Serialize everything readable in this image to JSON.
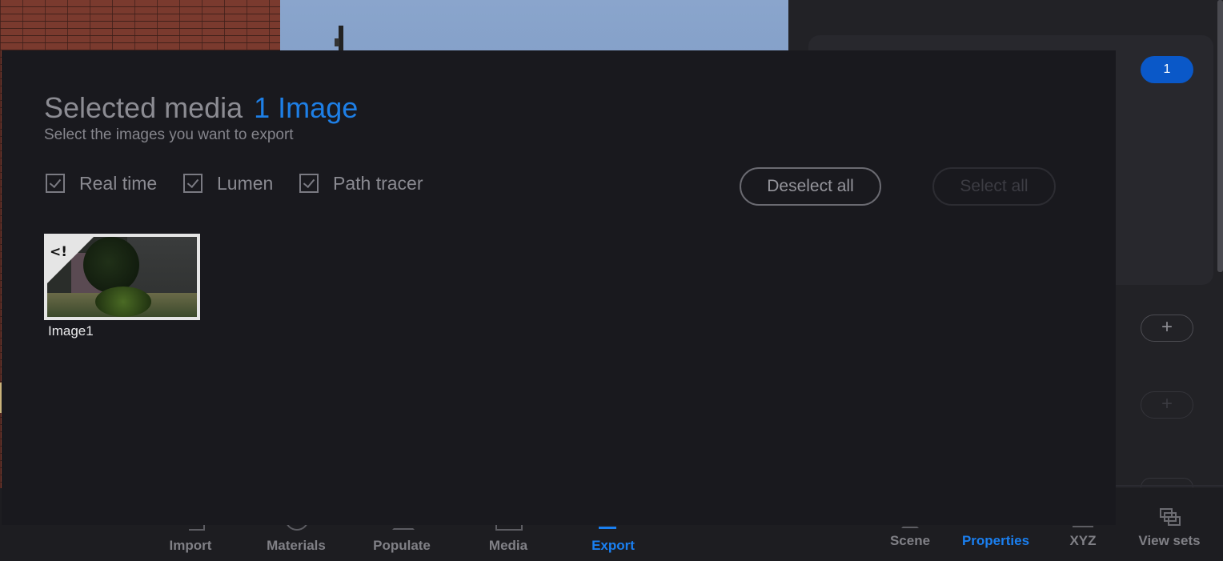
{
  "modal": {
    "title": "Selected media",
    "count_label": "1 Image",
    "subtitle": "Select the images you want to export",
    "filters": [
      {
        "label": "Real time",
        "checked": true
      },
      {
        "label": "Lumen",
        "checked": true
      },
      {
        "label": "Path tracer",
        "checked": true
      }
    ],
    "deselect_all": "Deselect all",
    "select_all": "Select all",
    "images": [
      {
        "name": "Image1",
        "badge_icon": "realtime-renderer-icon",
        "selected": true
      }
    ]
  },
  "right_panel": {
    "count_badge": "1",
    "add_icon": "plus-icon"
  },
  "toolbar": {
    "left_items": [
      {
        "label": "Import",
        "active": false
      },
      {
        "label": "Materials",
        "active": false
      },
      {
        "label": "Populate",
        "active": false
      },
      {
        "label": "Media",
        "active": false
      },
      {
        "label": "Export",
        "active": true
      }
    ],
    "right_items": [
      {
        "label": "Scene",
        "active": false
      },
      {
        "label": "Properties",
        "active": true
      },
      {
        "label": "XYZ",
        "active": false
      },
      {
        "label": "View sets",
        "active": false
      }
    ]
  },
  "colors": {
    "accent": "#1e7fe6",
    "badge_blue": "#0a58c8",
    "modal_bg": "#19191e"
  }
}
